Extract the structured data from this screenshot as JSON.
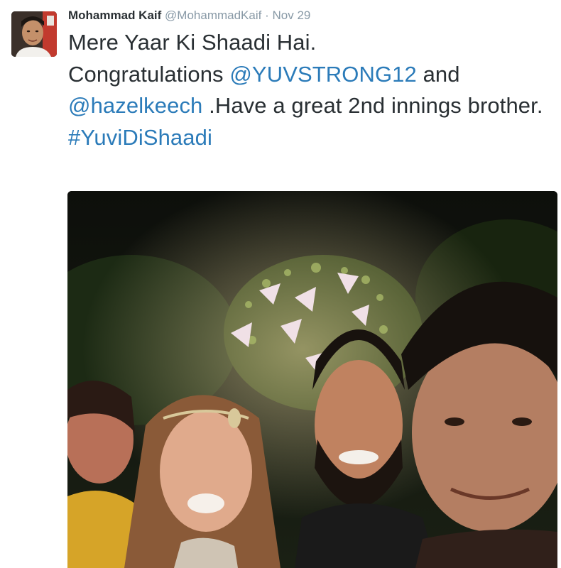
{
  "tweet": {
    "author_name": "Mohammad Kaif",
    "author_handle": "@MohammadKaif",
    "separator": "·",
    "date": "Nov 29",
    "text_line1": "Mere Yaar Ki Shaadi Hai.",
    "text_congrats": "Congratulations ",
    "mention1": "@YUVSTRONG12",
    "text_and": " and",
    "mention2": "@hazelkeech",
    "text_rest": " .Have a great 2nd innings brother.",
    "hashtag": "#YuviDiShaadi"
  },
  "colors": {
    "name": "#292f33",
    "meta": "#8899a6",
    "link": "#2b7bb9",
    "text": "#292f33"
  },
  "media": {
    "type": "photo",
    "icon": "photo-selfie"
  }
}
